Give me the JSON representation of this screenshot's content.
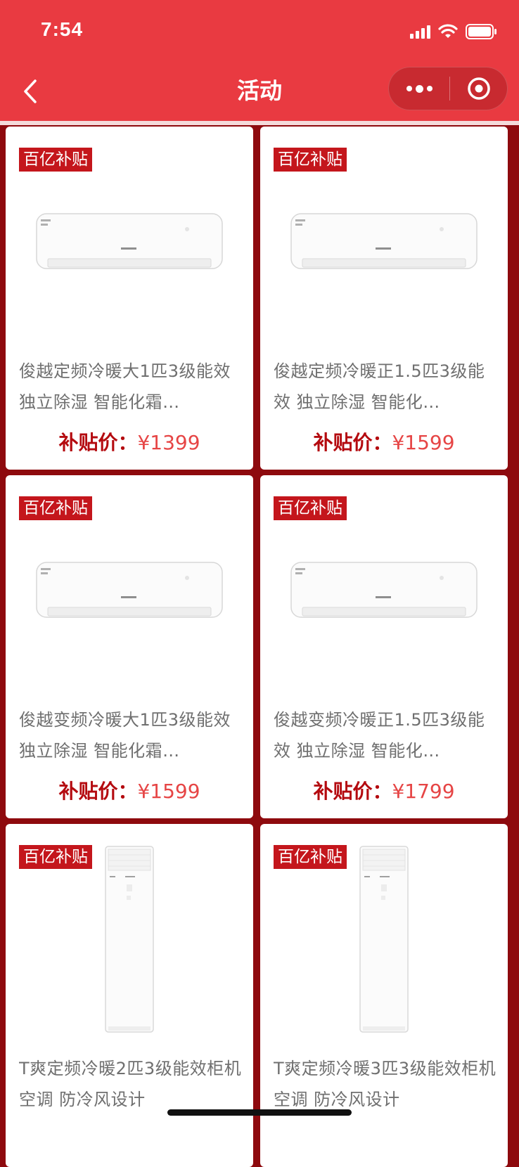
{
  "status_bar": {
    "time": "7:54"
  },
  "nav": {
    "title": "活动"
  },
  "products": [
    {
      "badge": "百亿补贴",
      "title": "俊越定频冷暖大1匹3级能效 独立除湿 智能化霜…",
      "price_label": "补贴价：",
      "price": "¥1399",
      "type": "split"
    },
    {
      "badge": "百亿补贴",
      "title": "俊越定频冷暖正1.5匹3级能效 独立除湿 智能化…",
      "price_label": "补贴价：",
      "price": "¥1599",
      "type": "split"
    },
    {
      "badge": "百亿补贴",
      "title": "俊越变频冷暖大1匹3级能效 独立除湿 智能化霜…",
      "price_label": "补贴价：",
      "price": "¥1599",
      "type": "split"
    },
    {
      "badge": "百亿补贴",
      "title": "俊越变频冷暖正1.5匹3级能效 独立除湿 智能化…",
      "price_label": "补贴价：",
      "price": "¥1799",
      "type": "split"
    },
    {
      "badge": "百亿补贴",
      "title": "T爽定频冷暖2匹3级能效柜机空调 防冷风设计",
      "price_label": "",
      "price": "",
      "type": "tower"
    },
    {
      "badge": "百亿补贴",
      "title": "T爽定频冷暖3匹3级能效柜机空调 防冷风设计",
      "price_label": "",
      "price": "",
      "type": "tower"
    }
  ]
}
